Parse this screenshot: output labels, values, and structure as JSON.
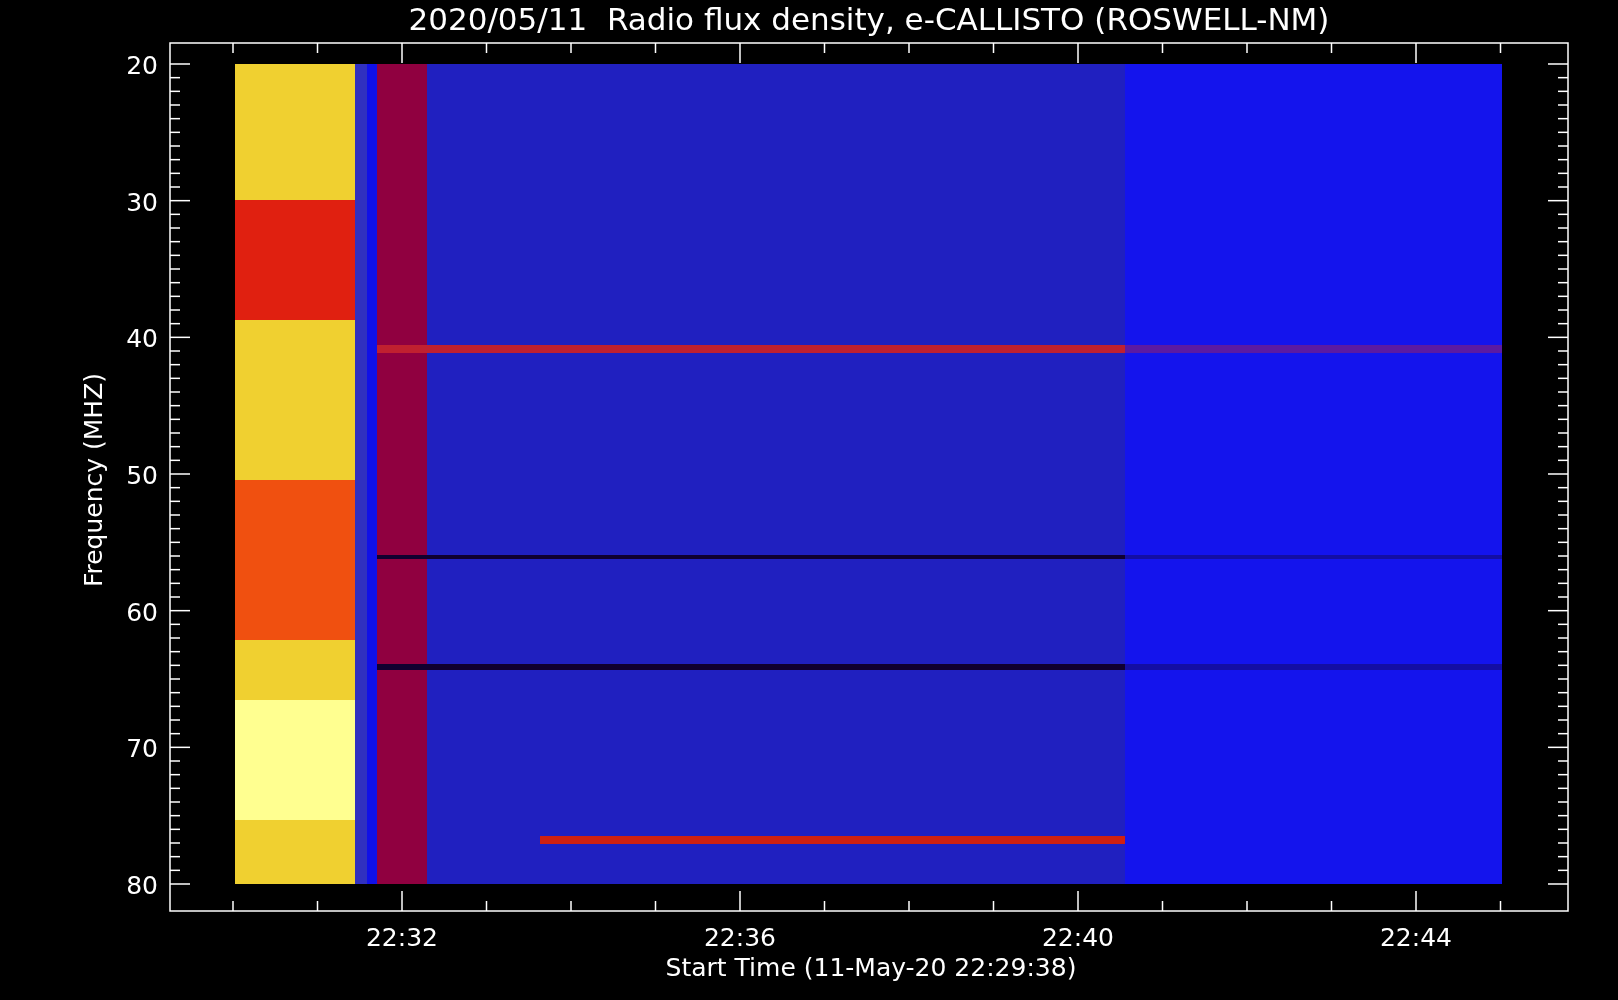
{
  "title": "2020/05/11  Radio flux density, e-CALLISTO (ROSWELL-NM)",
  "y_axis": {
    "label": "Frequency (MHZ)",
    "ticks": [
      "20",
      "30",
      "40",
      "50",
      "60",
      "70",
      "80"
    ]
  },
  "x_axis": {
    "label": "Start Time (11-May-20 22:29:38)",
    "ticks": [
      "22:32",
      "22:36",
      "22:40",
      "22:44"
    ]
  }
}
